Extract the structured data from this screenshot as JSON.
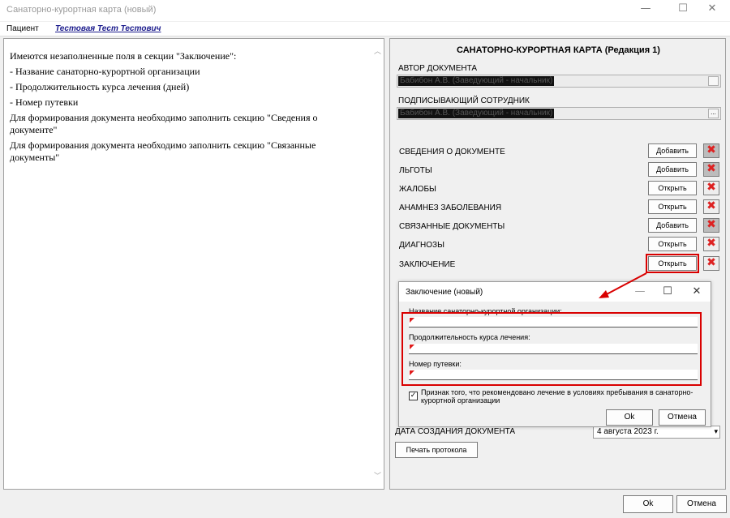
{
  "window": {
    "title": "Санаторно-курортная карта (новый)",
    "minimize": "—",
    "maximize": "☐",
    "close": "✕"
  },
  "patient": {
    "label": "Пациент",
    "name": "Тестовая Тест Тестович"
  },
  "messages": [
    "Имеются незаполненные поля в секции \"Заключение\":",
    "- Название санаторно-курортной организации",
    "- Продолжительность курса лечения (дней)",
    "- Номер путевки",
    "Для формирования документа необходимо заполнить секцию \"Сведения о документе\"",
    "Для формирования документа необходимо заполнить секцию \"Связанные документы\""
  ],
  "card": {
    "title": "САНАТОРНО-КУРОРТНАЯ КАРТА (Редакция 1)",
    "author_label": "АВТОР ДОКУМЕНТА",
    "author_value": "Бабибон А.В. (Заведующий - начальник)",
    "signer_label": "ПОДПИСЫВАЮЩИЙ СОТРУДНИК",
    "signer_value": "Бабибон А.В. (Заведующий - начальник)",
    "dots": "...",
    "delete_glyph": "✖",
    "sections": [
      {
        "label": "СВЕДЕНИЯ О ДОКУМЕНТЕ",
        "button": "Добавить"
      },
      {
        "label": "ЛЬГОТЫ",
        "button": "Добавить"
      },
      {
        "label": "ЖАЛОБЫ",
        "button": "Открыть"
      },
      {
        "label": "АНАМНЕЗ ЗАБОЛЕВАНИЯ",
        "button": "Открыть"
      },
      {
        "label": "СВЯЗАННЫЕ ДОКУМЕНТЫ",
        "button": "Добавить"
      },
      {
        "label": "ДИАГНОЗЫ",
        "button": "Открыть"
      },
      {
        "label": "ЗАКЛЮЧЕНИЕ",
        "button": "Открыть"
      }
    ],
    "date_label": "ДАТА СОЗДАНИЯ ДОКУМЕНТА",
    "date_value": "4 августа 2023 г.",
    "print_button": "Печать протокола"
  },
  "dialog": {
    "title": "Заключение (новый)",
    "minimize": "—",
    "maximize": "☐",
    "close": "✕",
    "field1_label": "Название санаторно-курортной организации:",
    "field2_label": "Продолжительность курса лечения:",
    "field3_label": "Номер путевки:",
    "checkbox_checked": "✓",
    "checkbox_label": "Признак того, что рекомендовано лечение в условиях пребывания в санаторно-курортной организации",
    "ok": "Ok",
    "cancel": "Отмена"
  },
  "footer": {
    "ok": "Ok",
    "cancel": "Отмена"
  },
  "colors": {
    "highlight": "#d90000",
    "link": "#1a1a8c"
  }
}
